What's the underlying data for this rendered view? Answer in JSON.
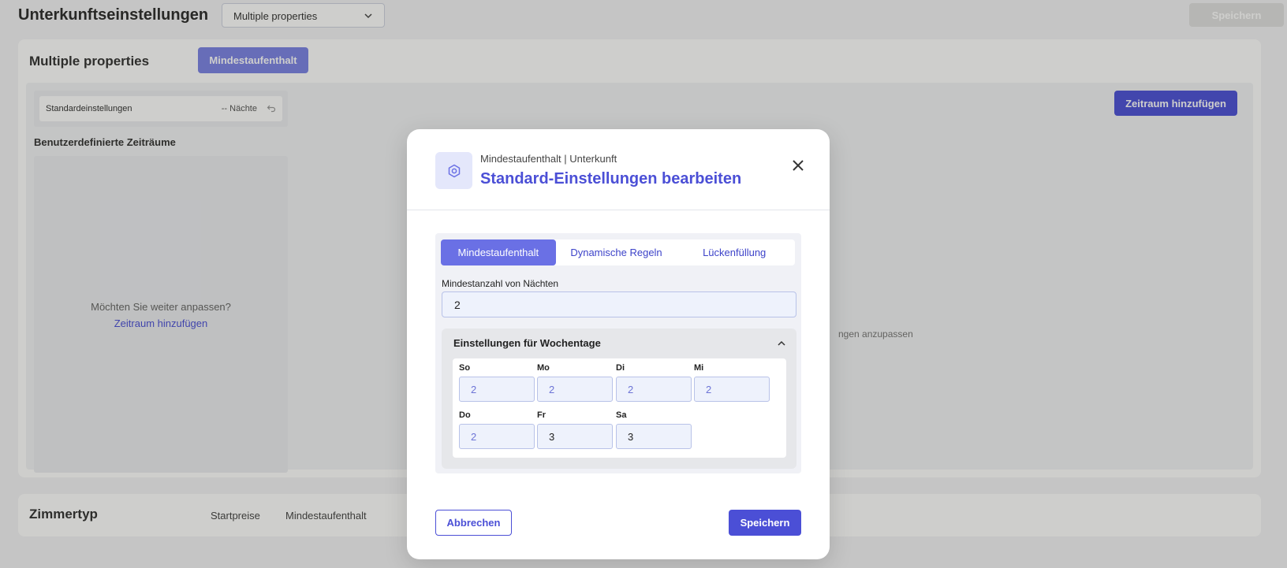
{
  "page": {
    "title": "Unterkunftseinstellungen",
    "property_select": "Multiple properties",
    "save_label": "Speichern"
  },
  "main_card": {
    "title": "Multiple properties",
    "active_tab": "Mindestaufenthalt",
    "standard_label": "Standardeinstellungen",
    "standard_value": "-- Nächte",
    "custom_periods_title": "Benutzerdefinierte Zeiträume",
    "custom_question": "Möchten Sie weiter anpassen?",
    "custom_link": "Zeitraum hinzufügen",
    "add_period_button": "Zeitraum hinzufügen",
    "hint_text_partial": "ngen anzupassen"
  },
  "room_card": {
    "title": "Zimmertyp",
    "col1": "Startpreise",
    "col2": "Mindestaufenthalt"
  },
  "modal": {
    "subtitle": "Mindestaufenthalt | Unterkunft",
    "title": "Standard-Einstellungen bearbeiten",
    "tabs": [
      {
        "label": "Mindestaufenthalt",
        "active": true
      },
      {
        "label": "Dynamische Regeln",
        "active": false
      },
      {
        "label": "Lückenfüllung",
        "active": false
      }
    ],
    "min_nights_label": "Mindestanzahl von Nächten",
    "min_nights_value": "2",
    "weekday_title": "Einstellungen für Wochentage",
    "days": [
      {
        "label": "So",
        "value": "2"
      },
      {
        "label": "Mo",
        "value": "2"
      },
      {
        "label": "Di",
        "value": "2"
      },
      {
        "label": "Mi",
        "value": "2"
      },
      {
        "label": "Do",
        "value": "2"
      },
      {
        "label": "Fr",
        "value": "3"
      },
      {
        "label": "Sa",
        "value": "3"
      }
    ],
    "cancel_label": "Abbrechen",
    "save_label": "Speichern"
  },
  "colors": {
    "accent": "#4b4fd6",
    "accent_light": "#6a70e5",
    "input_bg": "#eef2fc"
  },
  "icons": [
    "chevron-down-icon",
    "undo-icon",
    "settings-gear-icon",
    "close-icon",
    "chevron-up-icon"
  ]
}
